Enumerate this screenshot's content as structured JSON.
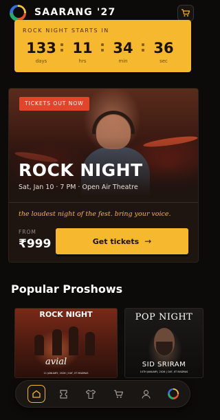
{
  "header": {
    "brand": "SAARANG '27",
    "logo_icon": "saarang-logo-icon",
    "cart_icon": "cart-icon"
  },
  "countdown": {
    "label": "ROCK NIGHT STARTS IN",
    "days": "133",
    "days_label": "days",
    "hrs": "11",
    "hrs_label": "hrs",
    "min": "34",
    "min_label": "min",
    "sec": "36",
    "sec_label": "sec"
  },
  "hero": {
    "badge": "TICKETS OUT NOW",
    "title": "ROCK NIGHT",
    "subtitle": "Sat, Jan 10 · 7 PM · Open Air Theatre",
    "tagline": "the loudest night of the fest. bring your voice.",
    "from_label": "FROM",
    "price": "₹999",
    "cta_label": "Get tickets",
    "cta_arrow": "→"
  },
  "proshows": {
    "title": "Popular Proshows",
    "cards": [
      {
        "title": "ROCK NIGHT",
        "artist": "avial",
        "fine": "11 JANUARY, 2026 | OAT, IIT MADRAS"
      },
      {
        "title": "POP NIGHT",
        "artist": "SID SRIRAM",
        "fine": "10TH JANUARY, 2026 | OAT, IIT MADRAS"
      }
    ]
  },
  "nav": {
    "items": [
      {
        "icon": "home-icon",
        "active": true
      },
      {
        "icon": "ticket-icon",
        "active": false
      },
      {
        "icon": "tshirt-icon",
        "active": false
      },
      {
        "icon": "cart-icon",
        "active": false
      },
      {
        "icon": "profile-icon",
        "active": false
      },
      {
        "icon": "saarang-logo-icon",
        "active": false
      }
    ]
  },
  "colors": {
    "accent": "#f6b82e",
    "badge": "#e1452b",
    "background": "#0d0b0a"
  }
}
